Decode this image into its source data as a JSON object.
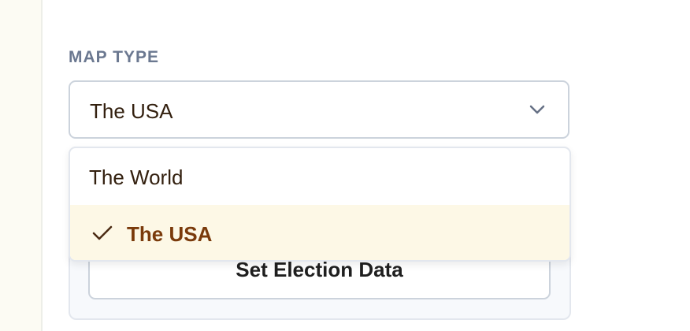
{
  "form": {
    "map_type_label": "MAP TYPE",
    "selected_value": "The USA",
    "options": [
      {
        "label": "The World",
        "selected": false
      },
      {
        "label": "The USA",
        "selected": true
      }
    ],
    "set_data_button_label": "Set Election Data"
  },
  "icons": {
    "dropdown_chevron": "chevron-down-icon",
    "selected_check": "checkmark-icon"
  },
  "colors": {
    "label": "#6b7890",
    "text": "#33200f",
    "selected_text": "#7a3a0b",
    "selected_bg": "#fdf8e6",
    "border": "#ccd3dc"
  }
}
